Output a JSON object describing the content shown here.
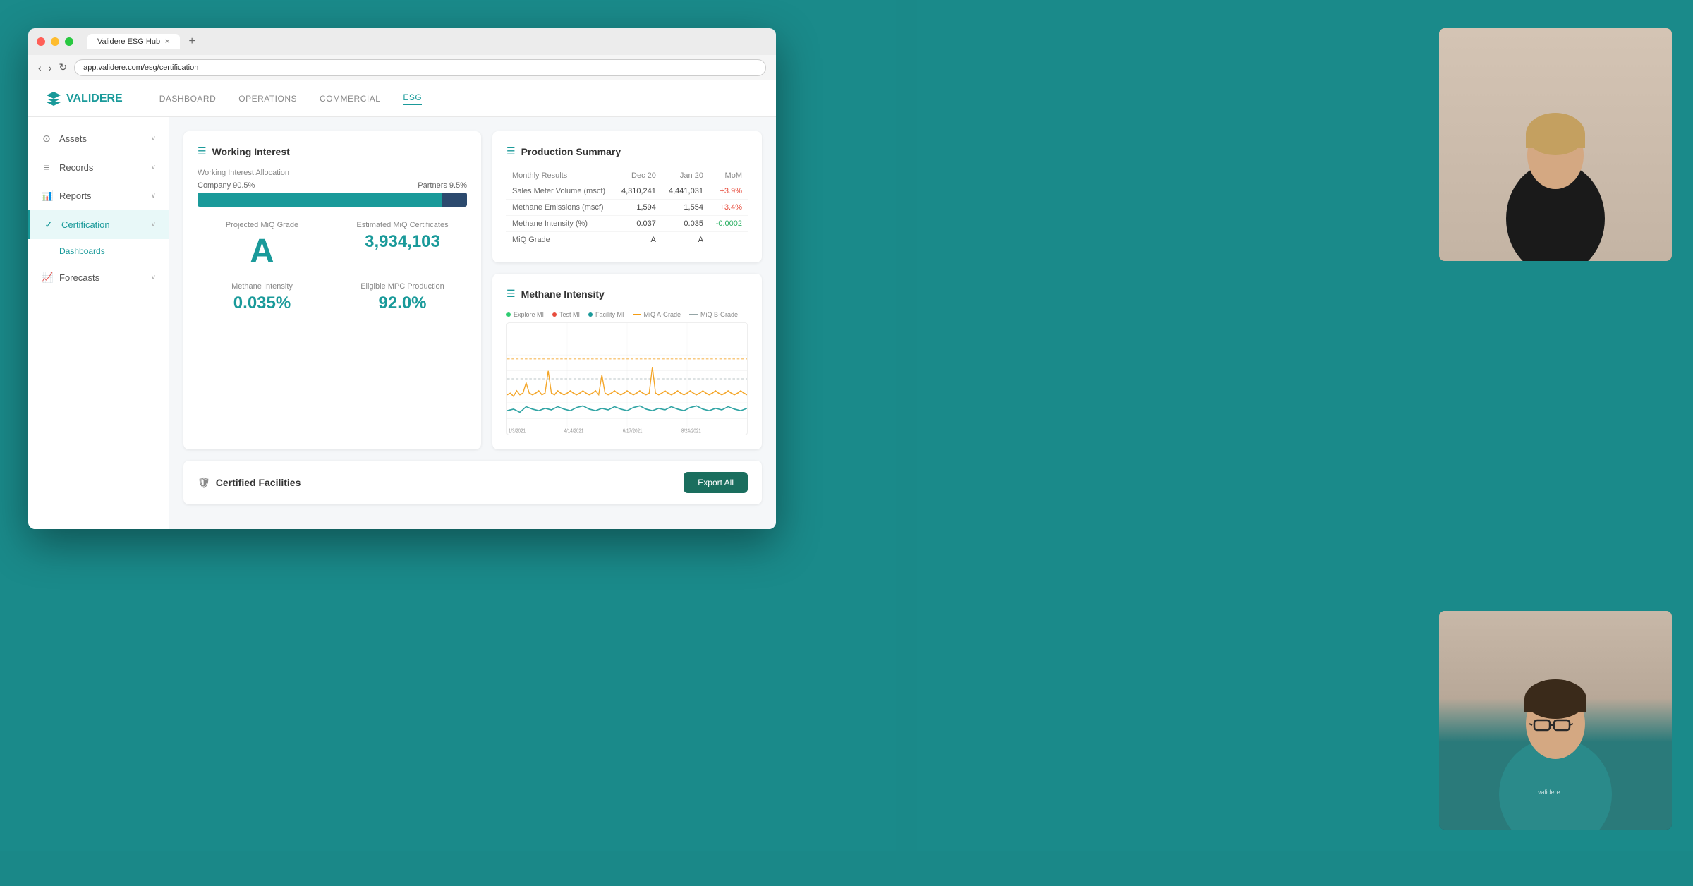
{
  "browser": {
    "tab_title": "Validere ESG Hub",
    "url": "app.validere.com/esg/certification",
    "new_tab_label": "+"
  },
  "top_nav": {
    "logo_text": "VALIDERE",
    "items": [
      {
        "label": "DASHBOARD",
        "active": false
      },
      {
        "label": "OPERATIONS",
        "active": false
      },
      {
        "label": "COMMERCIAL",
        "active": false
      },
      {
        "label": "ESG",
        "active": true
      }
    ]
  },
  "sidebar": {
    "items": [
      {
        "label": "Assets",
        "icon": "○",
        "expanded": true
      },
      {
        "label": "Records",
        "icon": "📋",
        "expanded": true
      },
      {
        "label": "Reports",
        "icon": "📊",
        "expanded": true
      },
      {
        "label": "Certification",
        "icon": "✓",
        "active": true,
        "expanded": true
      },
      {
        "label": "Dashboards",
        "sub": true
      },
      {
        "label": "Forecasts",
        "icon": "📈",
        "expanded": false
      }
    ]
  },
  "working_interest": {
    "title": "Working Interest",
    "allocation_label": "Working Interest Allocation",
    "company_label": "Company",
    "company_pct": "90.5%",
    "partners_label": "Partners",
    "partners_pct": "9.5%",
    "company_bar_width": 90.5,
    "partners_bar_width": 9.5,
    "projected_label": "Projected MiQ Grade",
    "projected_value": "A",
    "estimated_label": "Estimated MiQ Certificates",
    "estimated_value": "3,934,103",
    "methane_label": "Methane Intensity",
    "methane_value": "0.035%",
    "eligible_label": "Eligible MPC Production",
    "eligible_value": "92.0%"
  },
  "production_summary": {
    "title": "Production Summary",
    "columns": [
      "Monthly Results",
      "Dec 20",
      "Jan 20",
      "MoM"
    ],
    "rows": [
      {
        "label": "Sales Meter Volume (mscf)",
        "dec": "4,310,241",
        "jan": "4,441,031",
        "mom": "+3.9%",
        "trend": "positive"
      },
      {
        "label": "Methane Emissions (mscf)",
        "dec": "1,594",
        "jan": "1,554",
        "mom": "+3.4%",
        "trend": "positive"
      },
      {
        "label": "Methane Intensity (%)",
        "dec": "0.037",
        "jan": "0.035",
        "mom": "-0.0002",
        "trend": "negative"
      },
      {
        "label": "MiQ Grade",
        "dec": "A",
        "jan": "A",
        "mom": "",
        "trend": ""
      }
    ]
  },
  "methane_intensity": {
    "title": "Methane Intensity",
    "legend": [
      {
        "label": "Explore MI",
        "color": "#2ecc71",
        "type": "line"
      },
      {
        "label": "Test MI",
        "color": "#e74c3c",
        "type": "line"
      },
      {
        "label": "Facility MI",
        "color": "#1a9a9a",
        "type": "line"
      },
      {
        "label": "MiQ A-Grade",
        "color": "#f39c12",
        "type": "dash"
      },
      {
        "label": "MiQ B-Grade",
        "color": "#95a5a6",
        "type": "dash"
      }
    ],
    "x_labels": [
      "1/3/2021",
      "4/14/2021",
      "6/17/2021",
      "8/24/2021"
    ]
  },
  "certified_facilities": {
    "title": "Certified Facilities",
    "export_btn": "Export All"
  }
}
